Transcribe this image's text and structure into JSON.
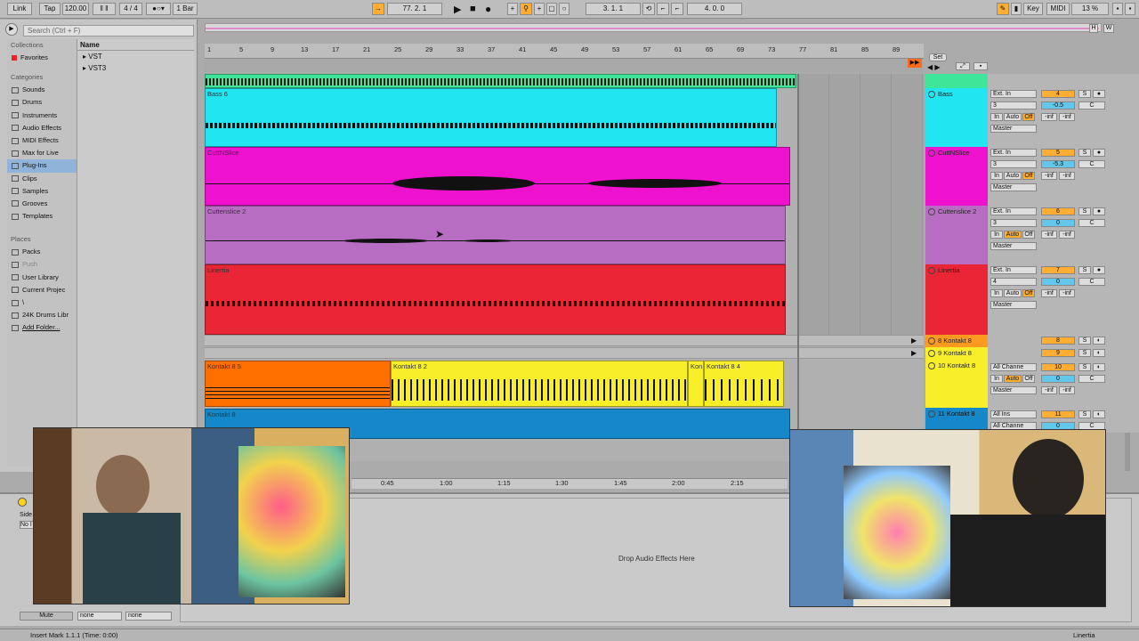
{
  "toolbar": {
    "link": "Link",
    "tap": "Tap",
    "tempo": "120.00",
    "signature": "4 / 4",
    "quantize": "1 Bar",
    "position": "77.   2.   1",
    "loop_start": "3.   1.   1",
    "loop_length": "4.   0.   0",
    "key": "Key",
    "midi": "MIDI",
    "cpu": "13 %"
  },
  "browser": {
    "search_placeholder": "Search (Ctrl + F)",
    "collections_header": "Collections",
    "favorites": "Favorites",
    "categories_header": "Categories",
    "categories": [
      "Sounds",
      "Drums",
      "Instruments",
      "Audio Effects",
      "MIDI Effects",
      "Max for Live",
      "Plug-Ins",
      "Clips",
      "Samples",
      "Grooves",
      "Templates"
    ],
    "places_header": "Places",
    "places": [
      "Packs",
      "Push",
      "User Library",
      "Current Projec",
      "\\",
      "24K Drums Libr",
      "Add Folder..."
    ],
    "name_header": "Name",
    "items": [
      "VST",
      "VST3"
    ]
  },
  "ruler": {
    "bars": [
      "1",
      "5",
      "9",
      "13",
      "17",
      "21",
      "25",
      "29",
      "33",
      "37",
      "41",
      "45",
      "49",
      "53",
      "57",
      "61",
      "65",
      "69",
      "73",
      "77",
      "81",
      "85",
      "89"
    ],
    "set_label": "Set"
  },
  "clips": {
    "bass": "Bass 6",
    "cutt": "CuttNSlice",
    "cutt2": "Cuttenslice 2",
    "linertia": "Linertia",
    "kontakt85": "Kontakt 8 5",
    "kontakt82": "Kontakt 8 2",
    "kon": "Kon",
    "kontakt84": "Kontakt 8 4",
    "kontakt8": "Kontakt 8"
  },
  "tracks": [
    {
      "name": "Bass",
      "input": "Ext. In",
      "channel": "3",
      "num": "4",
      "vol": "-0.5",
      "pan": "C",
      "send1": "-inf",
      "send2": "-inf",
      "out": "Master",
      "color": "#22e5f2"
    },
    {
      "name": "CuttNSlice",
      "input": "Ext. In",
      "channel": "3",
      "num": "5",
      "vol": "-5.3",
      "pan": "C",
      "send1": "-inf",
      "send2": "-inf",
      "out": "Master",
      "color": "#ee12cf"
    },
    {
      "name": "Cuttenslice 2",
      "input": "Ext. In",
      "channel": "3",
      "num": "6",
      "vol": "0",
      "pan": "C",
      "send1": "-inf",
      "send2": "-inf",
      "out": "Master",
      "color": "#b76ec2"
    },
    {
      "name": "Linertia",
      "input": "Ext. In",
      "channel": "4",
      "num": "7",
      "vol": "0",
      "pan": "C",
      "send1": "-inf",
      "send2": "-inf",
      "out": "Master",
      "color": "#ea2535"
    }
  ],
  "small_tracks": [
    {
      "name": "8 Kontakt 8",
      "num": "8"
    },
    {
      "name": "9 Kontakt 8",
      "num": "9"
    }
  ],
  "kontakt10": {
    "name": "10 Kontakt 8",
    "input": "All Channe",
    "num": "10",
    "vol": "0",
    "pan": "C",
    "send1": "-inf",
    "send2": "-inf",
    "out": "Master"
  },
  "kontakt11": {
    "name": "11 Kontakt 8",
    "input": "All Ins",
    "input2": "All Channe",
    "num": "11",
    "vol": "0",
    "pan": "C"
  },
  "mixer_labels": {
    "in": "In",
    "auto": "Auto",
    "off": "Off",
    "s": "S"
  },
  "time_ruler": [
    "0:45",
    "1:00",
    "1:15",
    "1:30",
    "1:45",
    "2:00",
    "2:15"
  ],
  "device": {
    "drop_text": "Drop Audio Effects Here",
    "mute": "Mute",
    "none1": "none",
    "none2": "none",
    "side_label": "Side",
    "no_label": "No I"
  },
  "status": {
    "text": "Insert Mark 1.1.1 (Time: 0:00)",
    "track_name": "Linertia"
  }
}
